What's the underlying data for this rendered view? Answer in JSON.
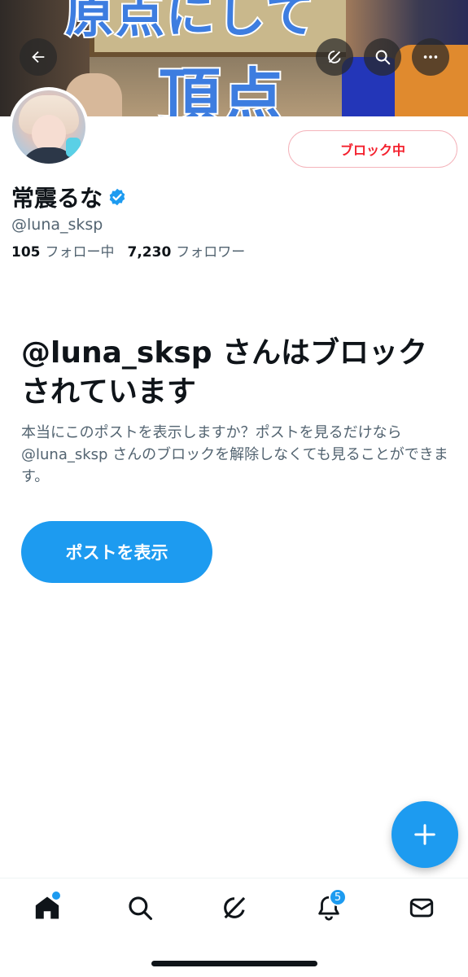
{
  "banner": {
    "text_top": "原点にして",
    "text_bottom": "頂点"
  },
  "header": {
    "back_icon": "arrow-left-icon",
    "grok_icon": "grok-icon",
    "search_icon": "search-icon",
    "more_icon": "more-horizontal-icon"
  },
  "profile": {
    "display_name": "常震るな",
    "handle": "@luna_sksp",
    "blocked_button_label": "ブロック中",
    "following_count": "105",
    "following_label": "フォロー中",
    "followers_count": "7,230",
    "followers_label": "フォロワー"
  },
  "blocked_notice": {
    "title": "@luna_sksp さんはブロックされています",
    "description": "本当にこのポストを表示しますか？ポストを見るだけなら @luna_sksp さんのブロックを解除しなくても見ることができます。",
    "view_posts_label": "ポストを表示"
  },
  "tabbar": {
    "notifications_badge": "5"
  },
  "colors": {
    "accent": "#1d9bf0",
    "danger": "#f4212e",
    "text_primary": "#0f1419",
    "text_secondary": "#536471"
  }
}
